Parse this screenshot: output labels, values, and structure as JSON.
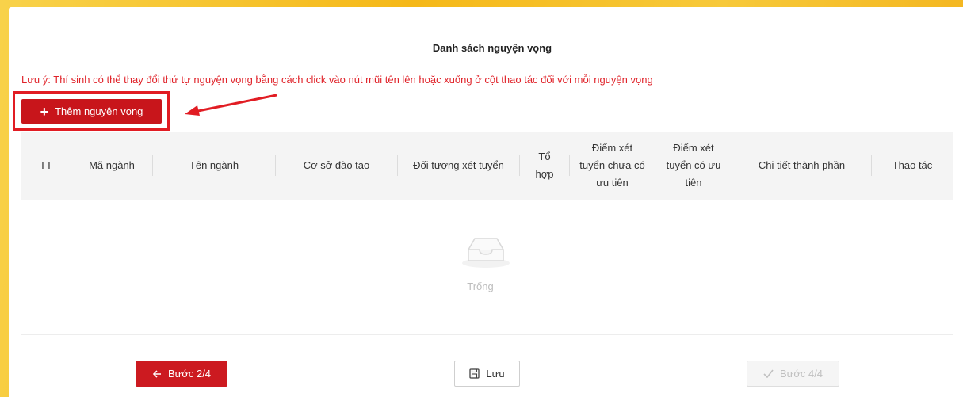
{
  "section": {
    "title": "Danh sách nguyện vọng"
  },
  "note": "Lưu ý: Thí sinh có thể thay đổi thứ tự nguyện vọng bằng cách click vào nút mũi tên lên hoặc xuống ở cột thao tác đối với mỗi nguyện vọng",
  "add_button": {
    "label": "Thêm nguyện vọng",
    "icon": "plus-icon"
  },
  "table": {
    "columns": [
      {
        "label": "TT"
      },
      {
        "label": "Mã ngành"
      },
      {
        "label": "Tên ngành"
      },
      {
        "label": "Cơ sở đào tạo"
      },
      {
        "label": "Đối tượng xét tuyển"
      },
      {
        "label": "Tổ hợp"
      },
      {
        "label": "Điểm xét tuyển chưa có ưu tiên"
      },
      {
        "label": "Điểm xét tuyển có ưu tiên"
      },
      {
        "label": "Chi tiết thành phần"
      },
      {
        "label": "Thao tác"
      }
    ],
    "rows": [],
    "empty_text": "Trống"
  },
  "footer": {
    "prev_label": "Bước 2/4",
    "save_label": "Lưu",
    "next_label": "Bước 4/4",
    "next_disabled": true
  },
  "colors": {
    "accent": "#c8151b",
    "note": "#e0232a",
    "highlight": "#e11c23",
    "background": "#f5b818"
  }
}
